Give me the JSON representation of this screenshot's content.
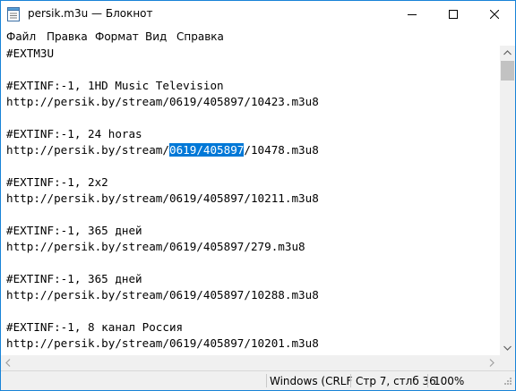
{
  "window": {
    "title": "persik.m3u — Блокнот",
    "controls": [
      "minimize",
      "maximize",
      "close"
    ]
  },
  "menu": [
    "Файл",
    "Правка",
    "Формат",
    "Вид",
    "Справка"
  ],
  "editor": {
    "lines": [
      {
        "text": "#EXTM3U"
      },
      {
        "text": ""
      },
      {
        "text": "#EXTINF:-1, 1HD Music Television"
      },
      {
        "text": "http://persik.by/stream/0619/405897/10423.m3u8"
      },
      {
        "text": ""
      },
      {
        "text": "#EXTINF:-1, 24 horas"
      },
      {
        "text": "http://persik.by/stream/0619/405897/10478.m3u8",
        "pre": "http://persik.by/stream/",
        "selected": "0619/405897",
        "post": "/10478.m3u8"
      },
      {
        "text": ""
      },
      {
        "text": "#EXTINF:-1, 2x2"
      },
      {
        "text": "http://persik.by/stream/0619/405897/10211.m3u8"
      },
      {
        "text": ""
      },
      {
        "text": "#EXTINF:-1, 365 дней"
      },
      {
        "text": "http://persik.by/stream/0619/405897/279.m3u8"
      },
      {
        "text": ""
      },
      {
        "text": "#EXTINF:-1, 365 дней"
      },
      {
        "text": "http://persik.by/stream/0619/405897/10288.m3u8"
      },
      {
        "text": ""
      },
      {
        "text": "#EXTINF:-1, 8 канал Россия"
      },
      {
        "text": "http://persik.by/stream/0619/405897/10201.m3u8"
      }
    ]
  },
  "status": {
    "encoding": "Windows (CRLF",
    "position": "Стр 7, стлб 36",
    "zoom": "100%"
  },
  "colors": {
    "selection": "#0078d7",
    "border": "#1883d7",
    "chrome": "#f0f0f0"
  }
}
